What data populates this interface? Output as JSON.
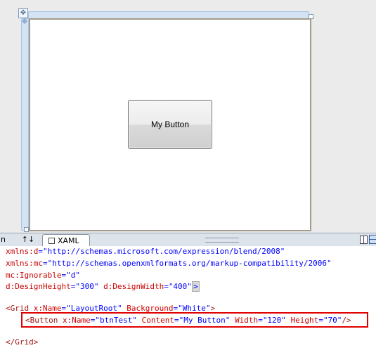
{
  "designer": {
    "preview_button_label": "My Button",
    "move_handle_glyph": "✥"
  },
  "tabbar": {
    "design_tab_label": "n",
    "swap_glyph": "↑↓",
    "xaml_tab_label": "XAML"
  },
  "code": {
    "line1": {
      "attr": "xmlns:d",
      "eq": "=",
      "val": "\"http://schemas.microsoft.com/expression/blend/2008\""
    },
    "line2": {
      "attr": "xmlns:mc",
      "eq": "=",
      "val": "\"http://schemas.openxmlformats.org/markup-compatibility/2006\""
    },
    "line3": {
      "attr": "mc:Ignorable",
      "eq": "=",
      "val": "\"d\""
    },
    "line4": {
      "attr1": "d:DesignHeight",
      "eq": "=",
      "val1": "\"300\"",
      "attr2": "d:DesignWidth",
      "val2": "\"400\"",
      "close": ">"
    },
    "line5": {
      "open": "<Grid",
      "attr1": "x:Name",
      "val1": "\"LayoutRoot\"",
      "attr2": "Background",
      "val2": "\"White\"",
      "close": ">"
    },
    "line6": {
      "open": "<Button",
      "attr1": "x:Name",
      "val1": "\"btnTest\"",
      "attr2": "Content",
      "val2": "\"My Button\"",
      "attr3": "Width",
      "val3": "\"120\"",
      "attr4": "Height",
      "val4": "\"70\"",
      "close": "/>"
    },
    "line7": {
      "close_tag": "</Grid>"
    }
  },
  "colors": {
    "attribute": "#cc0000",
    "value": "#0000ff",
    "tag": "#a31515",
    "highlight_border": "#e00000"
  }
}
